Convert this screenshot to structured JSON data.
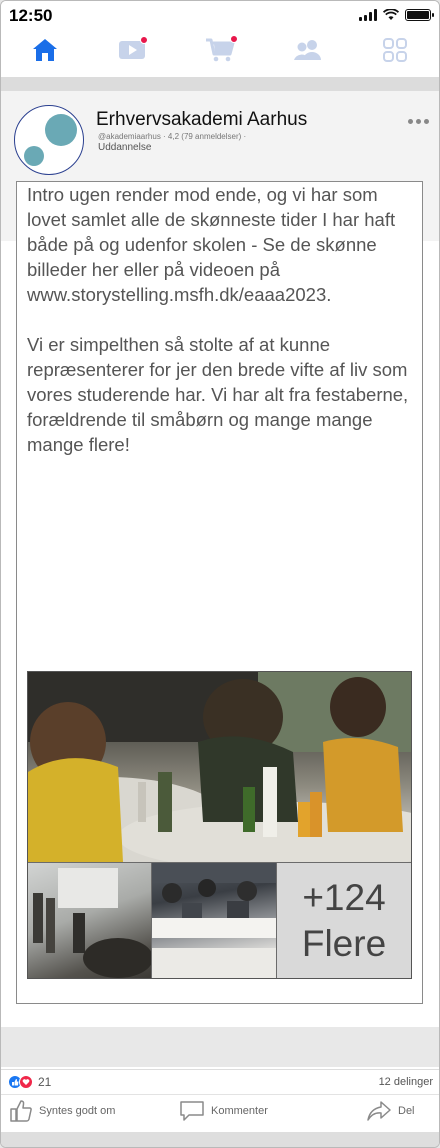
{
  "status_bar": {
    "time": "12:50"
  },
  "nav": {
    "items": [
      {
        "name": "home",
        "active": true,
        "badge": false
      },
      {
        "name": "video",
        "active": false,
        "badge": true
      },
      {
        "name": "marketplace",
        "active": false,
        "badge": true
      },
      {
        "name": "groups",
        "active": false,
        "badge": false
      },
      {
        "name": "menu",
        "active": false,
        "badge": false
      }
    ],
    "colors": {
      "active": "#1a6ee8",
      "inactive": "#c7d3ea",
      "badge": "#e8174b"
    }
  },
  "post": {
    "page_name": "Erhvervsakademi Aarhus",
    "page_meta": "@akademiaarhus · 4,2 (79 anmeldelser) ·",
    "page_category": "Uddannelse",
    "text_paragraphs": [
      "Intro ugen render mod ende, og vi har som lovet samlet alle de skønneste tider I har haft både på og udenfor skolen - Se de skønne billeder her eller på videoen på www.storystelling.msfh.dk/eaaa2023.",
      "Vi er simpelthen så stolte af at kunne repræsenterer for jer den brede vifte af liv som vores studerende har. Vi har alt fra festaberne, forældrende til småbørn og mange mange mange flere!"
    ],
    "photos": {
      "more_count": "+124",
      "more_label": "Flere"
    }
  },
  "engagement": {
    "reaction_count": "21",
    "share_count": "12 delinger",
    "actions": {
      "like": "Syntes godt om",
      "comment": "Kommenter",
      "share": "Del"
    }
  }
}
